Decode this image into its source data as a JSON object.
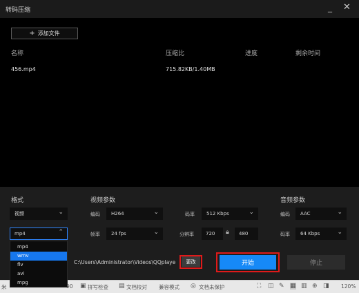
{
  "window": {
    "title": "转码压缩",
    "minimize_glyph": "_",
    "close_glyph": "✕"
  },
  "toolbar": {
    "add_file_label": "添加文件",
    "add_icon": "plus-icon"
  },
  "table": {
    "headers": {
      "name": "名称",
      "ratio": "压缩比",
      "progress": "进度",
      "remaining": "剩余时间"
    },
    "rows": [
      {
        "name": "456.mp4",
        "ratio": "715.82KB/1.40MB"
      }
    ]
  },
  "format": {
    "section": "格式",
    "type_value": "视频",
    "container_value": "mp4",
    "options": [
      "mp4",
      "wmv",
      "flv",
      "avi",
      "mpg"
    ],
    "selected_option": "wmv"
  },
  "video": {
    "section": "视频参数",
    "codec_label": "编码",
    "codec_value": "H264",
    "bitrate_label": "码率",
    "bitrate_value": "512 Kbps",
    "fps_label": "帧率",
    "fps_value": "24 fps",
    "resolution_label": "分辨率",
    "width": "720",
    "height": "480"
  },
  "audio": {
    "section": "音频参数",
    "codec_label": "编码",
    "codec_value": "AAC",
    "bitrate_label": "码率",
    "bitrate_value": "64 Kbps"
  },
  "output": {
    "path": "C:\\Users\\Administrator\\Videos\\QQplaye",
    "change_label": "更改"
  },
  "actions": {
    "start_label": "开始",
    "stop_label": "停止"
  },
  "statusbar": {
    "left_fragment": "米",
    "page_fragment": "90",
    "spell_check": "拼写检查",
    "proofread": "文档校对",
    "compat_mode": "兼容模式",
    "protect": "文档未保护",
    "zoom": "120%"
  },
  "colors": {
    "accent": "#1689f7",
    "highlight": "#e01a1a",
    "selected": "#1677ee"
  }
}
